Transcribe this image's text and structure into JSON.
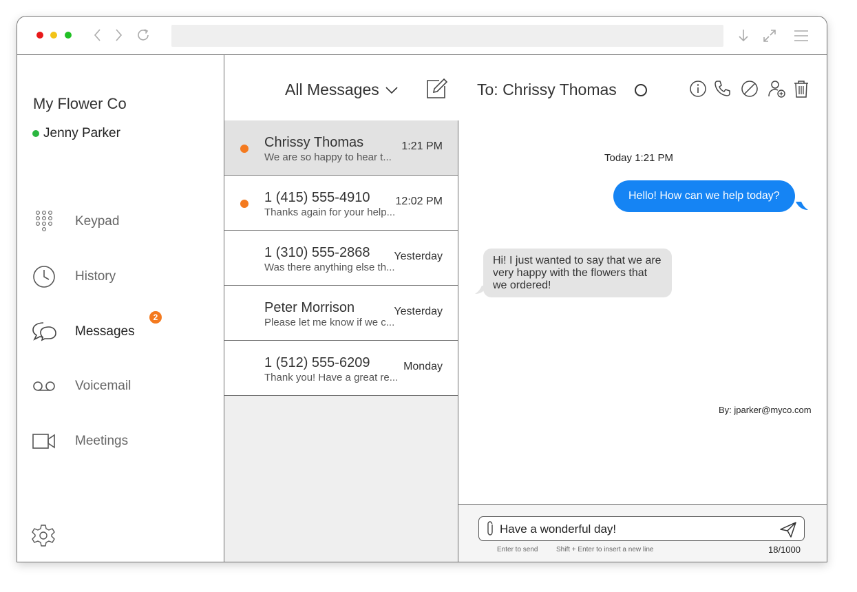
{
  "app": {
    "company": "My Flower Co",
    "user": "Jenny Parker",
    "user_status_color": "#2ab63f"
  },
  "sidebar": {
    "items": [
      {
        "label": "Keypad",
        "icon": "keypad-icon"
      },
      {
        "label": "History",
        "icon": "clock-icon"
      },
      {
        "label": "Messages",
        "icon": "chat-bubbles-icon",
        "badge": "2"
      },
      {
        "label": "Voicemail",
        "icon": "voicemail-icon"
      },
      {
        "label": "Meetings",
        "icon": "video-camera-icon"
      }
    ],
    "settings_icon": "gear-icon"
  },
  "header": {
    "filter_label": "All Messages",
    "recipient": "To: Chrissy  Thomas",
    "icons": [
      "compose-icon",
      "info-icon",
      "phone-icon",
      "block-icon",
      "add-contact-icon",
      "trash-icon"
    ]
  },
  "conversations": [
    {
      "name": "Chrissy  Thomas",
      "preview": "We are so happy to hear t...",
      "time": "1:21 PM",
      "unread": true,
      "selected": true
    },
    {
      "name": "1 (415) 555-4910",
      "preview": "Thanks again for your help...",
      "time": "12:02 PM",
      "unread": true,
      "selected": false
    },
    {
      "name": "1 (310) 555-2868",
      "preview": "Was there anything else th...",
      "time": "Yesterday",
      "unread": false,
      "selected": false
    },
    {
      "name": "Peter Morrison",
      "preview": "Please let me know if we c...",
      "time": "Yesterday",
      "unread": false,
      "selected": false
    },
    {
      "name": "1 (512) 555-6209",
      "preview": "Thank you! Have a great re...",
      "time": "Monday",
      "unread": false,
      "selected": false
    }
  ],
  "chat": {
    "day_stamp": "Today 1:21 PM",
    "outgoing": "Hello! How can we help today?",
    "incoming": "Hi! I just wanted to say that we are very happy with the flowers that we ordered!",
    "sent_by": "By: jparker@myco.com"
  },
  "composer": {
    "draft": "Have a wonderful day!",
    "hint_send": "Enter to send",
    "hint_newline": "Shift + Enter to insert a new line",
    "char_count": "18/1000"
  },
  "colors": {
    "accent_blue": "#1584f4",
    "unread_orange": "#f47a1f"
  }
}
